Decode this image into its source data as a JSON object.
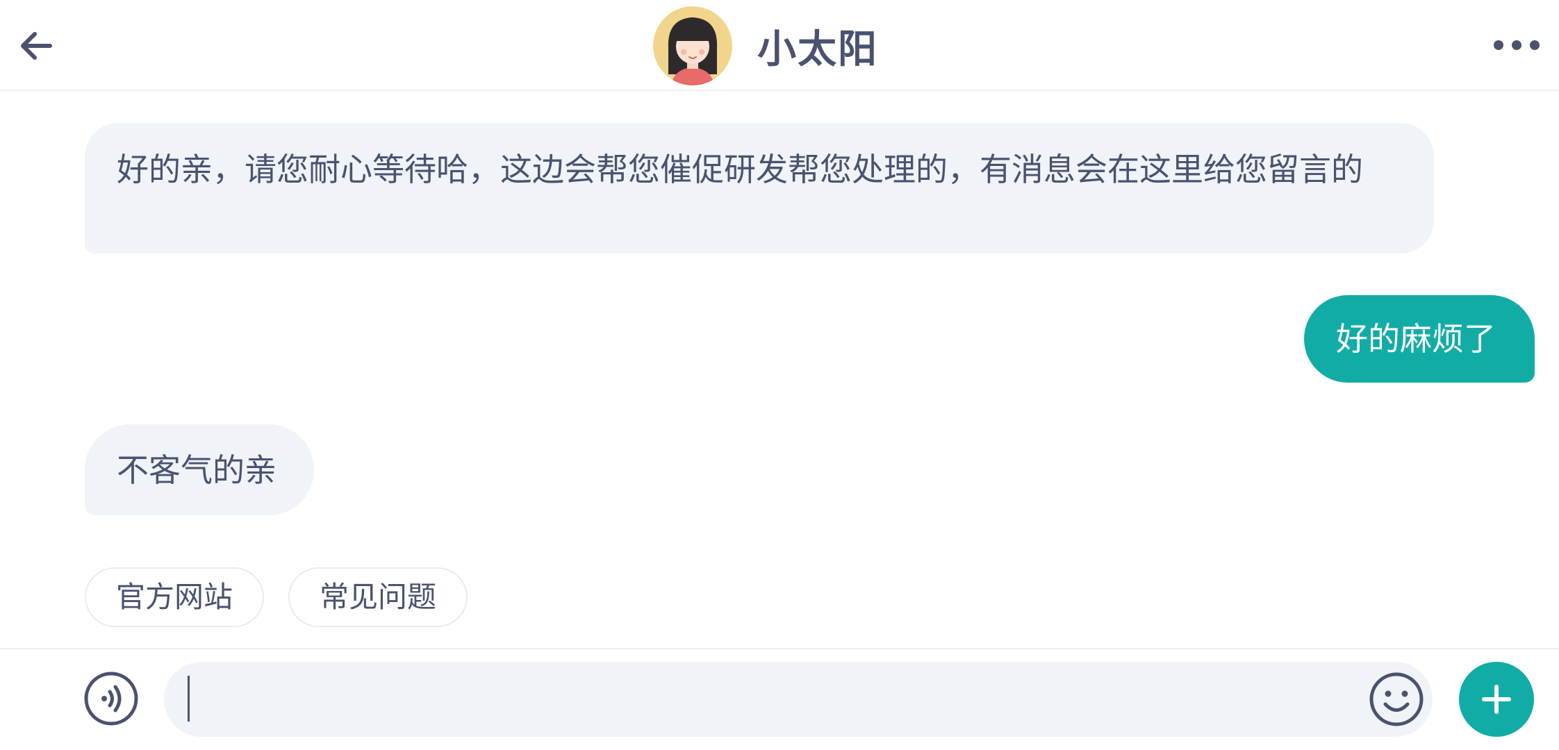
{
  "header": {
    "back_icon": "arrow-left-icon",
    "title": "小太阳",
    "more_icon": "more-dots-icon"
  },
  "messages": [
    {
      "side": "incoming",
      "text": "好的亲，请您耐心等待哈，这边会帮您催促研发帮您处理的，有消息会在这里给您留言的"
    },
    {
      "side": "outgoing",
      "text": "好的麻烦了"
    },
    {
      "side": "incoming",
      "text": "不客气的亲"
    }
  ],
  "quick_replies": [
    {
      "label": "官方网站"
    },
    {
      "label": "常见问题"
    }
  ],
  "composer": {
    "value": "",
    "placeholder": "",
    "voice_icon": "voice-icon",
    "emoji_icon": "emoji-icon",
    "plus_icon": "plus-icon"
  },
  "colors": {
    "accent": "#12aca7",
    "incoming_bubble": "#f0f3f7",
    "text": "#4a5270"
  }
}
